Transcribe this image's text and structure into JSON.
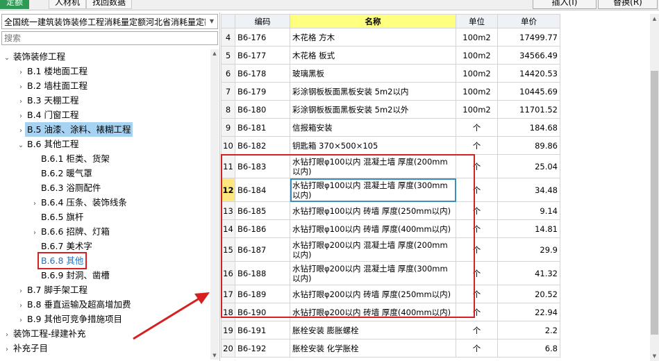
{
  "toolbar": {
    "tabs": [
      "定额",
      "人材机",
      "找回数据"
    ],
    "insert_label": "插入(I)",
    "replace_label": "替换(R)"
  },
  "left_panel": {
    "quota_library": "全国统一建筑装饰装修工程消耗量定额河北省消耗量定额",
    "search_placeholder": "搜索",
    "tree": [
      {
        "label": "装饰装修工程",
        "level": 0,
        "state": "expanded"
      },
      {
        "label": "B.1 楼地面工程",
        "level": 1,
        "state": "collapsed"
      },
      {
        "label": "B.2 墙柱面工程",
        "level": 1,
        "state": "collapsed"
      },
      {
        "label": "B.3 天棚工程",
        "level": 1,
        "state": "collapsed"
      },
      {
        "label": "B.4 门窗工程",
        "level": 1,
        "state": "collapsed"
      },
      {
        "label": "B.5 油漆、涂料、裱糊工程",
        "level": 1,
        "state": "collapsed",
        "selected": true
      },
      {
        "label": "B.6 其他工程",
        "level": 1,
        "state": "expanded"
      },
      {
        "label": "B.6.1 柜类、货架",
        "level": 2,
        "state": "leaf"
      },
      {
        "label": "B.6.2 暖气罩",
        "level": 2,
        "state": "leaf"
      },
      {
        "label": "B.6.3 浴厕配件",
        "level": 2,
        "state": "leaf"
      },
      {
        "label": "B.6.4 压条、装饰线条",
        "level": 2,
        "state": "collapsed"
      },
      {
        "label": "B.6.5 旗杆",
        "level": 2,
        "state": "leaf"
      },
      {
        "label": "B.6.6 招牌、灯箱",
        "level": 2,
        "state": "collapsed"
      },
      {
        "label": "B.6.7 美术字",
        "level": 2,
        "state": "leaf"
      },
      {
        "label": "B.6.8 其他",
        "level": 2,
        "state": "leaf",
        "boxed": true
      },
      {
        "label": "B.6.9 封洞、凿槽",
        "level": 2,
        "state": "leaf"
      },
      {
        "label": "B.7 脚手架工程",
        "level": 1,
        "state": "collapsed"
      },
      {
        "label": "B.8 垂直运输及超高增加费",
        "level": 1,
        "state": "collapsed"
      },
      {
        "label": "B.9 其他可竞争措施项目",
        "level": 1,
        "state": "collapsed"
      },
      {
        "label": "装饰工程-绿建补充",
        "level": 0,
        "state": "collapsed"
      },
      {
        "label": "补充子目",
        "level": 0,
        "state": "collapsed"
      }
    ]
  },
  "table": {
    "columns": [
      "",
      "编码",
      "名称",
      "单位",
      "单价"
    ],
    "current_row": "12",
    "rows": [
      {
        "idx": "4",
        "code": "B6-176",
        "name": "木花格 方木",
        "unit": "100m2",
        "price": "17499.77"
      },
      {
        "idx": "5",
        "code": "B6-177",
        "name": "木花格 板式",
        "unit": "100m2",
        "price": "34566.49"
      },
      {
        "idx": "6",
        "code": "B6-178",
        "name": "玻璃黑板",
        "unit": "100m2",
        "price": "14420.53"
      },
      {
        "idx": "7",
        "code": "B6-179",
        "name": "彩涂钢板板面黑板安装 5m2以内",
        "unit": "100m2",
        "price": "10445.69"
      },
      {
        "idx": "8",
        "code": "B6-180",
        "name": "彩涂钢板板面黑板安装 5m2以外",
        "unit": "100m2",
        "price": "11701.52"
      },
      {
        "idx": "9",
        "code": "B6-181",
        "name": "信报箱安装",
        "unit": "个",
        "price": "184.68"
      },
      {
        "idx": "10",
        "code": "B6-182",
        "name": "钥匙箱 370×500×105",
        "unit": "个",
        "price": "89.86"
      },
      {
        "idx": "11",
        "code": "B6-183",
        "name": "水钻打眼φ100以内 混凝土墙 厚度(200mm以内)",
        "unit": "个",
        "price": "25.04"
      },
      {
        "idx": "12",
        "code": "B6-184",
        "name": "水钻打眼φ100以内 混凝土墙 厚度(300mm以内)",
        "unit": "个",
        "price": "34.48"
      },
      {
        "idx": "13",
        "code": "B6-185",
        "name": "水钻打眼φ100以内 砖墙 厚度(250mm以内)",
        "unit": "个",
        "price": "9.14"
      },
      {
        "idx": "14",
        "code": "B6-186",
        "name": "水钻打眼φ100以内 砖墙 厚度(400mm以内)",
        "unit": "个",
        "price": "14.81"
      },
      {
        "idx": "15",
        "code": "B6-187",
        "name": "水钻打眼φ200以内 混凝土墙 厚度(200mm以内)",
        "unit": "个",
        "price": "29.9"
      },
      {
        "idx": "16",
        "code": "B6-188",
        "name": "水钻打眼φ200以内 混凝土墙 厚度(300mm以内)",
        "unit": "个",
        "price": "41.32"
      },
      {
        "idx": "17",
        "code": "B6-189",
        "name": "水钻打眼φ200以内 砖墙 厚度(250mm以内)",
        "unit": "个",
        "price": "20.52"
      },
      {
        "idx": "18",
        "code": "B6-190",
        "name": "水钻打眼φ200以内 砖墙 厚度(400mm以内)",
        "unit": "个",
        "price": "22.94"
      },
      {
        "idx": "19",
        "code": "B6-191",
        "name": "胀栓安装 膨胀螺栓",
        "unit": "个",
        "price": "2.2"
      },
      {
        "idx": "20",
        "code": "B6-192",
        "name": "胀栓安装 化学胀栓",
        "unit": "个",
        "price": "6.8"
      }
    ]
  },
  "colors": {
    "tree_selected": "#a6d3f2",
    "annotation_red": "#d42020",
    "header_name": "#ffff80",
    "current_row_index": "#ffe680",
    "active_tab": "#2f9a55"
  }
}
